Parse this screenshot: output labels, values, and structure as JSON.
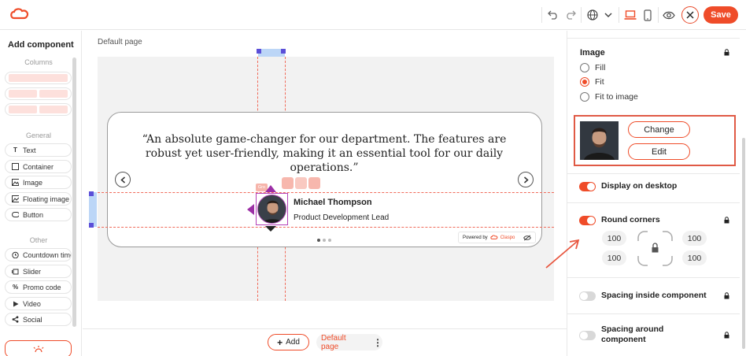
{
  "topbar": {
    "save_label": "Save",
    "colors": {
      "accent": "#ef4c29"
    },
    "icons": [
      "claspo-logo-icon",
      "undo-icon",
      "redo-icon",
      "globe-icon",
      "chevron-down-icon",
      "desktop-icon",
      "mobile-icon",
      "eye-icon",
      "close-icon"
    ]
  },
  "left_panel": {
    "title": "Add component",
    "sections": {
      "columns": "Columns",
      "general": "General",
      "other": "Other"
    },
    "general_items": [
      "Text",
      "Container",
      "Image",
      "Floating image",
      "Button"
    ],
    "other_items": [
      "Countdown timer",
      "Slider",
      "Promo code",
      "Video",
      "Social"
    ]
  },
  "canvas": {
    "page_label": "Default page",
    "quote": "“An absolute game-changer for our department. The features are robust yet user-friendly, making it an essential tool for our daily operations.”",
    "person_name": "Michael Thompson",
    "person_role": "Product Development Lead",
    "powered_by": "Powered by",
    "brand": "Claspo",
    "selection_tag": "Gro"
  },
  "bottom_bar": {
    "add_label": "Add",
    "page_label": "Default page"
  },
  "right_panel": {
    "image_title": "Image",
    "fit_options": [
      "Fill",
      "Fit",
      "Fit to image"
    ],
    "fit_selected": "Fit",
    "change_label": "Change",
    "edit_label": "Edit",
    "display_desktop_label": "Display on desktop",
    "display_desktop_on": true,
    "round_corners_label": "Round corners",
    "round_corners_on": true,
    "corners": [
      "100",
      "100",
      "100",
      "100"
    ],
    "spacing_inside_label": "Spacing inside component",
    "spacing_inside_on": false,
    "spacing_around_label": "Spacing around component",
    "spacing_around_on": false
  }
}
